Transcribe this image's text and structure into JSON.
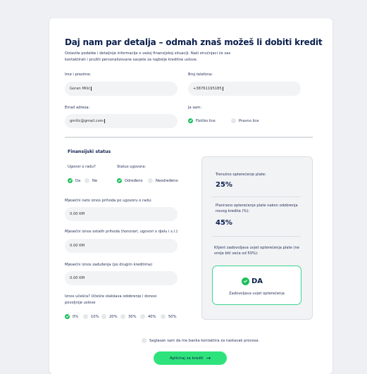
{
  "form": {
    "title": "Daj nam par detalja – odmah znaš možeš li dobiti kredit",
    "intro": "Ostavite podatke i detaljnije informacije o vašoj finansijskoj situaciji. Naši stručnjaci će vas kontaktirati i pružiti personalizovane savjete za najbolje kreditne uslove.",
    "name": {
      "label": "Ime i prezime:",
      "value": "Goran Milić"
    },
    "phone": {
      "label": "Broj telefona:",
      "value": "+38761195185"
    },
    "email": {
      "label": "Email adresa:",
      "value": "gmilic@gmail.com"
    },
    "person_type": {
      "label": "Ja sam:",
      "options": [
        {
          "label": "Fizičko lice",
          "selected": true
        },
        {
          "label": "Pravno lice",
          "selected": false
        }
      ]
    }
  },
  "finance": {
    "title": "Finansijski status",
    "contract": {
      "label": "Ugovor o radu?",
      "options": [
        {
          "label": "Da",
          "selected": true
        },
        {
          "label": "Ne",
          "selected": false
        }
      ]
    },
    "contract_status": {
      "label": "Status ugovora:",
      "options": [
        {
          "label": "Određeno",
          "selected": true
        },
        {
          "label": "Neodređeno",
          "selected": false
        }
      ]
    },
    "net_income": {
      "label": "Mjesečni neto iznos prihoda po ugovoru o radu:",
      "value": "0.00 KM"
    },
    "other_income": {
      "label": "Mjesečni iznos ostalih prihoda (honorari, ugovori o djelu i s.l.):",
      "value": "0.00 KM"
    },
    "debt": {
      "label": "Mjesečni iznos zaduženja (po drugim kreditima)",
      "value": "0.00 KM"
    },
    "participation": {
      "label": "Iznos učešća? Učešće olakšava odobrenje i donosi povoljnije uslove",
      "options": [
        {
          "label": "0%",
          "selected": true
        },
        {
          "label": "10%",
          "selected": false
        },
        {
          "label": "20%",
          "selected": false
        },
        {
          "label": "30%",
          "selected": false
        },
        {
          "label": "40%",
          "selected": false
        },
        {
          "label": "50%",
          "selected": false
        }
      ]
    }
  },
  "summary": {
    "current_label": "Trenutno opterećenje plate:",
    "current_value": "25%",
    "planned_label": "Planirano opterećenje plate nakon odobrenja novog kredita (%):",
    "planned_value": "45%",
    "check_label": "Klijent zadovoljava uvjet opterećenja plate (ne smije biti veća od 50%):",
    "result": "DA",
    "result_sub": "Zadovoljava uvjet opterećenja"
  },
  "consent_label": "Saglasan sam da me banka kontaktira za nastavak procesa.",
  "submit_label": "Apliciraj za kredit",
  "colors": {
    "accent": "#2ee37b",
    "check": "#1bbf5a",
    "navy": "#0b1f4d",
    "field": "#f2f3f5"
  },
  "icons": {
    "selected_radio": "check-circle-icon",
    "submit_arrow": "arrow-right-icon",
    "result_ok": "check-circle-icon"
  }
}
